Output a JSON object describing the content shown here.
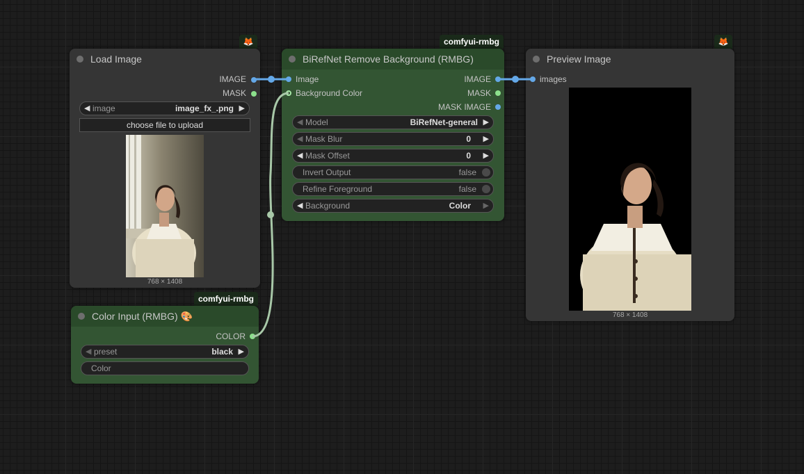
{
  "nodes": {
    "load_image": {
      "title": "Load Image",
      "outputs": [
        "IMAGE",
        "MASK"
      ],
      "image_widget": {
        "label": "image",
        "value": "image_fx_.png"
      },
      "upload_label": "choose file to upload",
      "image_size": "768 × 1408"
    },
    "color_input": {
      "badge": "comfyui-rmbg",
      "title": "Color Input (RMBG) 🎨",
      "output": "COLOR",
      "preset": {
        "label": "preset",
        "value": "black"
      },
      "color_label": "Color"
    },
    "birefnet": {
      "badge": "comfyui-rmbg",
      "title": "BiRefNet Remove Background (RMBG)",
      "inputs": [
        "Image",
        "Background Color"
      ],
      "outputs": [
        "IMAGE",
        "MASK",
        "MASK IMAGE"
      ],
      "widgets": {
        "model": {
          "label": "Model",
          "value": "BiRefNet-general"
        },
        "mask_blur": {
          "label": "Mask Blur",
          "value": "0"
        },
        "mask_offset": {
          "label": "Mask Offset",
          "value": "0"
        },
        "invert_output": {
          "label": "Invert Output",
          "value": "false"
        },
        "refine_foreground": {
          "label": "Refine Foreground",
          "value": "false"
        },
        "background": {
          "label": "Background",
          "value": "Color"
        }
      }
    },
    "preview": {
      "title": "Preview Image",
      "input": "images",
      "image_size": "768 × 1408"
    }
  },
  "colors": {
    "image_link": "#64a8e8",
    "mask_link": "#8ce08c",
    "color_link": "#a8c8a8",
    "node_gray": "#353535",
    "node_green": "#335533"
  },
  "icons": [
    "fox-icon",
    "palette-icon",
    "arrow-left-icon",
    "arrow-right-icon",
    "toggle-knob-icon"
  ]
}
